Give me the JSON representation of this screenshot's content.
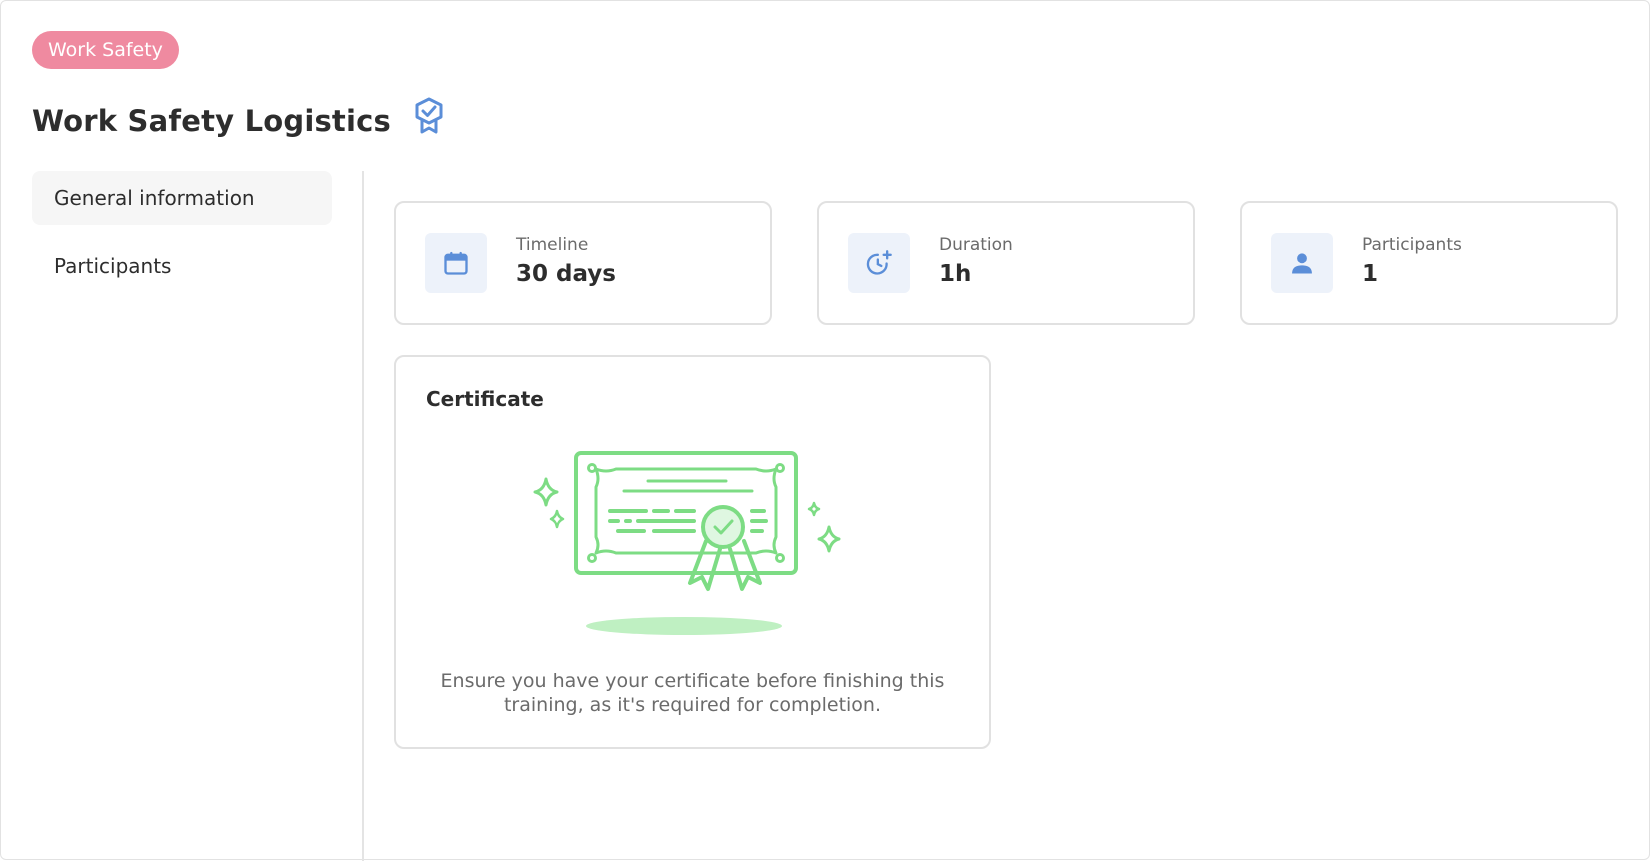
{
  "badge": {
    "label": "Work Safety",
    "color": "#ef8aa0"
  },
  "header": {
    "title": "Work Safety Logistics",
    "icon": "award-badge-icon"
  },
  "sidebar": {
    "items": [
      {
        "label": "General information",
        "active": true
      },
      {
        "label": "Participants",
        "active": false
      }
    ]
  },
  "stats": [
    {
      "label": "Timeline",
      "value": "30 days",
      "icon": "calendar-icon"
    },
    {
      "label": "Duration",
      "value": "1h",
      "icon": "clock-plus-icon"
    },
    {
      "label": "Participants",
      "value": "1",
      "icon": "person-icon"
    }
  ],
  "certificate": {
    "title": "Certificate",
    "description": "Ensure you have your certificate before finishing this training, as it's required for completion.",
    "illustration": "certificate-ribbon-illustration"
  },
  "colors": {
    "accent_blue": "#5b8ed8",
    "illustration_green": "#7ddc84",
    "badge_pink": "#ef8aa0"
  }
}
